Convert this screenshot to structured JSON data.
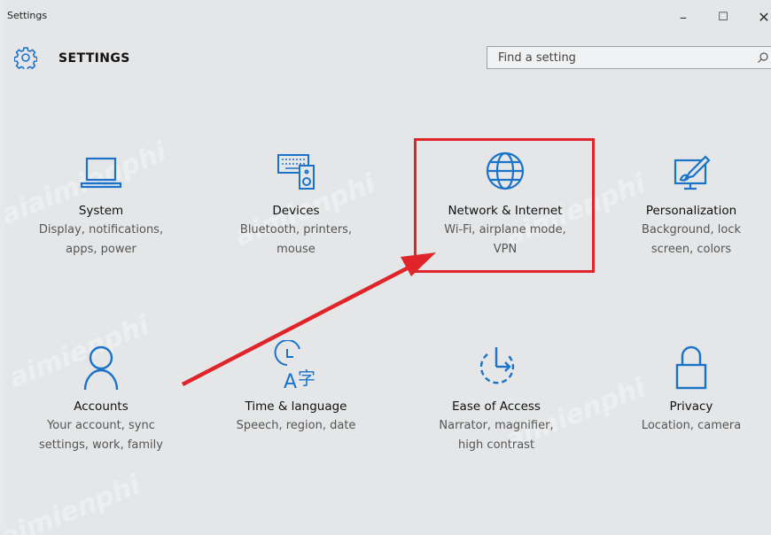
{
  "window": {
    "title": "Settings",
    "minimize": "–",
    "maximize": "☐",
    "close": "✕"
  },
  "header": {
    "heading": "SETTINGS",
    "search_placeholder": "Find a setting"
  },
  "tiles": [
    {
      "name": "System",
      "desc1": "Display, notifications,",
      "desc2": "apps, power",
      "icon": "laptop-icon"
    },
    {
      "name": "Devices",
      "desc1": "Bluetooth, printers,",
      "desc2": "mouse",
      "icon": "devices-icon"
    },
    {
      "name": "Network & Internet",
      "desc1": "Wi-Fi, airplane mode,",
      "desc2": "VPN",
      "icon": "globe-icon"
    },
    {
      "name": "Personalization",
      "desc1": "Background, lock",
      "desc2": "screen, colors",
      "icon": "paintbrush-icon"
    },
    {
      "name": "Accounts",
      "desc1": "Your account, sync",
      "desc2": "settings, work, family",
      "icon": "person-icon"
    },
    {
      "name": "Time & language",
      "desc1": "Speech, region, date",
      "desc2": "",
      "icon": "time-language-icon"
    },
    {
      "name": "Ease of Access",
      "desc1": "Narrator, magnifier,",
      "desc2": "high contrast",
      "icon": "ease-of-access-icon"
    },
    {
      "name": "Privacy",
      "desc1": "Location, camera",
      "desc2": "",
      "icon": "lock-icon"
    }
  ],
  "colors": {
    "accent": "#1a73c8",
    "highlight": "#e0252a",
    "background": "#e4e6e8"
  },
  "watermark": "aimienphi"
}
